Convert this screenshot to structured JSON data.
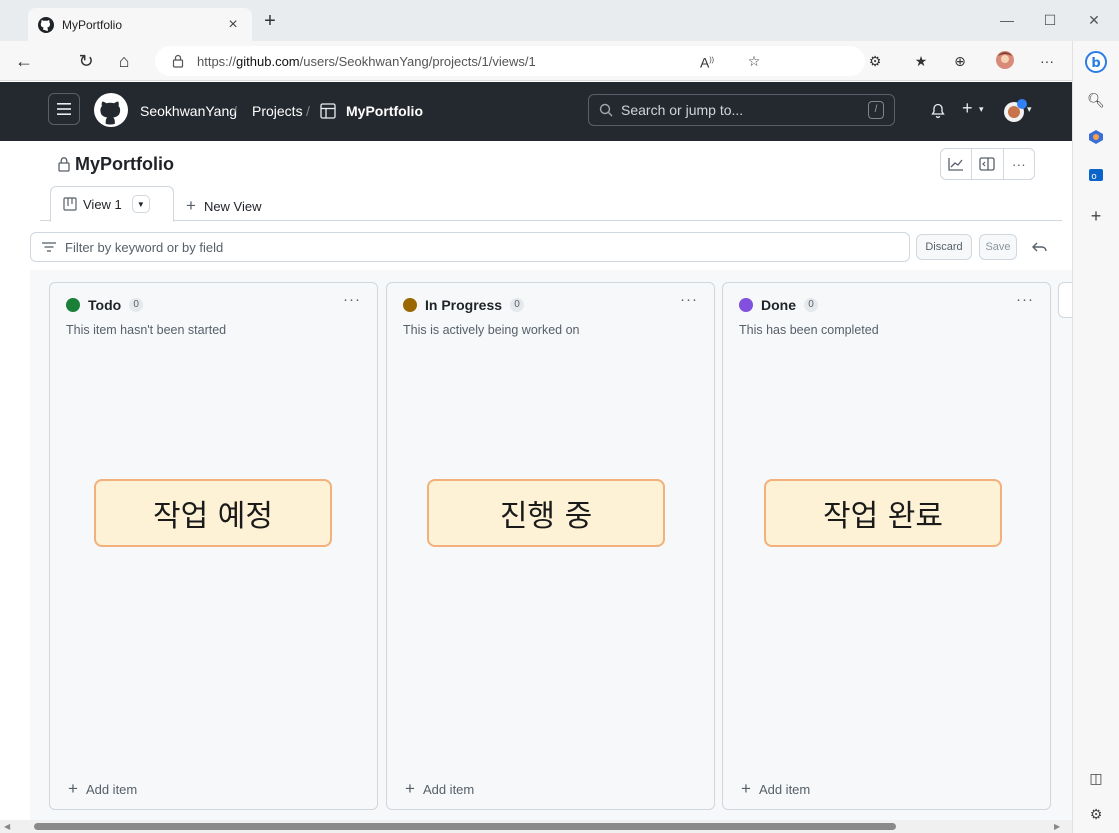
{
  "browser": {
    "tab_title": "MyPortfolio",
    "tab_close": "×",
    "new_tab": "+",
    "url_prefix": "https://",
    "url_host": "github.com",
    "url_path": "/users/SeokhwanYang/projects/1/views/1",
    "more_label": "···"
  },
  "header": {
    "user": "SeokhwanYang",
    "sep1": "/",
    "projects": "Projects",
    "sep2": "/",
    "project": "MyPortfolio",
    "search_placeholder": "Search or jump to...",
    "slash_key": "/",
    "plus_label": "+"
  },
  "project": {
    "title": "MyPortfolio",
    "more_label": "···"
  },
  "tabs": {
    "view_label": "View 1",
    "new_view_label": "New View"
  },
  "filter": {
    "placeholder": "Filter by keyword or by field",
    "discard_label": "Discard",
    "save_label": "Save"
  },
  "columns": [
    {
      "name": "Todo",
      "count": "0",
      "description": "This item hasn't been started",
      "color": "#1a7f37",
      "add_label": "Add item",
      "callout": "작업 예정",
      "more": "···"
    },
    {
      "name": "In Progress",
      "count": "0",
      "description": "This is actively being worked on",
      "color": "#9a6700",
      "add_label": "Add item",
      "callout": "진행 중",
      "more": "···"
    },
    {
      "name": "Done",
      "count": "0",
      "description": "This has been completed",
      "color": "#8250df",
      "add_label": "Add item",
      "callout": "작업 완료",
      "more": "···"
    }
  ]
}
